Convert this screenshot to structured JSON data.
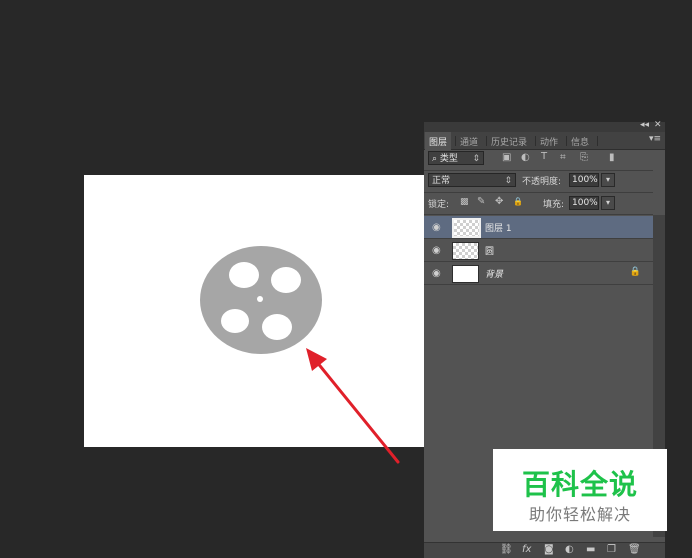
{
  "colors": {
    "workspace": "#282828",
    "panel": "#535353",
    "selected_layer": "#5e6b81",
    "reel": "#a6a6a6",
    "arrow": "#e0202a",
    "watermark_green": "#1ec24a"
  },
  "panel": {
    "collapse_glyph": "◂◂",
    "close_glyph": "✕",
    "menu_glyph": "▾≡",
    "tabs": [
      {
        "label": "图层",
        "active": true
      },
      {
        "label": "通道",
        "active": false
      },
      {
        "label": "历史记录",
        "active": false
      },
      {
        "label": "动作",
        "active": false
      },
      {
        "label": "信息",
        "active": false
      }
    ],
    "filter": {
      "search_glyph": "⌕",
      "kind_value": "类型",
      "icons": [
        "image-filter-icon",
        "adjustment-filter-icon",
        "type-filter-icon",
        "shape-filter-icon",
        "smart-object-filter-icon",
        "filter-toggle-icon"
      ],
      "icon_glyphs": [
        "▣",
        "◐",
        "T",
        "⌗",
        "⎘",
        "▮"
      ]
    },
    "blend": {
      "mode_value": "正常",
      "opacity_label": "不透明度:",
      "opacity_value": "100%"
    },
    "lock": {
      "label": "锁定:",
      "icons": [
        "lock-transparent-icon",
        "lock-paint-icon",
        "lock-position-icon",
        "lock-all-icon"
      ],
      "icon_glyphs": [
        "▩",
        "✎",
        "✥",
        "🔒"
      ],
      "fill_label": "填充:",
      "fill_value": "100%"
    },
    "layers": [
      {
        "name": "图层 1",
        "visible": true,
        "selected": true,
        "thumb": "transparent",
        "italic": false,
        "locked": false
      },
      {
        "name": "圆",
        "visible": true,
        "selected": false,
        "thumb": "transparent",
        "italic": false,
        "locked": false
      },
      {
        "name": "背景",
        "visible": true,
        "selected": false,
        "thumb": "white",
        "italic": true,
        "locked": true
      }
    ],
    "eye_glyph": "◉",
    "lock_glyph": "🔒",
    "bottom_icons": [
      "link-layers-icon",
      "layer-style-icon",
      "add-mask-icon",
      "adjustment-layer-icon",
      "new-group-icon",
      "new-layer-icon",
      "delete-layer-icon"
    ],
    "bottom_glyphs": [
      "⛓",
      "fx",
      "◙",
      "◐",
      "▬",
      "❐",
      "🗑"
    ]
  },
  "watermark": {
    "title": "百科全说",
    "subtitle": "助你轻松解决"
  }
}
